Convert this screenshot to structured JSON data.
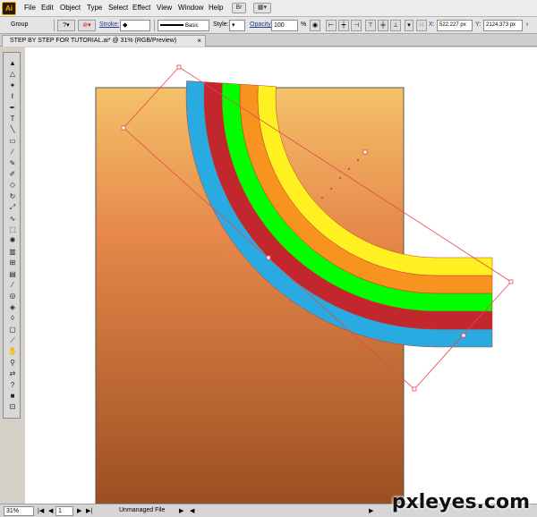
{
  "app": {
    "logo_text": "Ai"
  },
  "menu": [
    "File",
    "Edit",
    "Object",
    "Type",
    "Select",
    "Effect",
    "View",
    "Window",
    "Help"
  ],
  "control_bar": {
    "selection": "Group",
    "stroke_label": "Stroke:",
    "brush": "Basic",
    "style_label": "Style:",
    "opacity_label": "Opacity:",
    "opacity_value": "100",
    "opacity_unit": "%",
    "x_label": "X:",
    "x_value": "522.227 px",
    "y_label": "Y:",
    "y_value": "2124.373 px"
  },
  "document": {
    "tab_title": "STEP BY STEP FOR TUTORIAL.ai* @ 31% (RGB/Preview)",
    "close_glyph": "×"
  },
  "toolbar": {
    "tools": [
      {
        "name": "selection-tool",
        "glyph": "▲"
      },
      {
        "name": "direct-selection-tool",
        "glyph": "△"
      },
      {
        "name": "magic-wand-tool",
        "glyph": "✦"
      },
      {
        "name": "lasso-tool",
        "glyph": "ℓ"
      },
      {
        "name": "pen-tool",
        "glyph": "✒"
      },
      {
        "name": "type-tool",
        "glyph": "T"
      },
      {
        "name": "line-tool",
        "glyph": "╲"
      },
      {
        "name": "rectangle-tool",
        "glyph": "▭"
      },
      {
        "name": "paintbrush-tool",
        "glyph": "∕"
      },
      {
        "name": "pencil-tool",
        "glyph": "✎"
      },
      {
        "name": "blob-brush-tool",
        "glyph": "✐"
      },
      {
        "name": "eraser-tool",
        "glyph": "◇"
      },
      {
        "name": "rotate-tool",
        "glyph": "↻"
      },
      {
        "name": "scale-tool",
        "glyph": "⤢"
      },
      {
        "name": "warp-tool",
        "glyph": "∿"
      },
      {
        "name": "free-transform-tool",
        "glyph": "⬚"
      },
      {
        "name": "symbol-sprayer-tool",
        "glyph": "✺"
      },
      {
        "name": "column-graph-tool",
        "glyph": "▥"
      },
      {
        "name": "mesh-tool",
        "glyph": "⊞"
      },
      {
        "name": "gradient-tool",
        "glyph": "▤"
      },
      {
        "name": "eyedropper-tool",
        "glyph": "⁄"
      },
      {
        "name": "blend-tool",
        "glyph": "◎"
      },
      {
        "name": "live-paint-bucket-tool",
        "glyph": "◈"
      },
      {
        "name": "live-paint-selection-tool",
        "glyph": "◊"
      },
      {
        "name": "artboard-tool",
        "glyph": "▢"
      },
      {
        "name": "slice-tool",
        "glyph": "⟋"
      },
      {
        "name": "hand-tool",
        "glyph": "✋"
      },
      {
        "name": "zoom-tool",
        "glyph": "⚲"
      },
      {
        "name": "swap-fill-stroke",
        "glyph": "⇄"
      },
      {
        "name": "fill-stroke-swatch",
        "glyph": "?"
      },
      {
        "name": "color-mode",
        "glyph": "■"
      },
      {
        "name": "screen-mode",
        "glyph": "⊡"
      }
    ]
  },
  "status_bar": {
    "zoom": "31%",
    "page": "1",
    "file_status": "Unmanaged File"
  },
  "watermark": "pxleyes.com",
  "colors": {
    "artboard_top": "#f4c16a",
    "artboard_mid": "#e6894a",
    "artboard_bottom": "#9c4f22",
    "rainbow": [
      "#fff021",
      "#f7931e",
      "#00ff00",
      "#c1272d",
      "#29abe2"
    ],
    "selection": "#e5484d"
  }
}
